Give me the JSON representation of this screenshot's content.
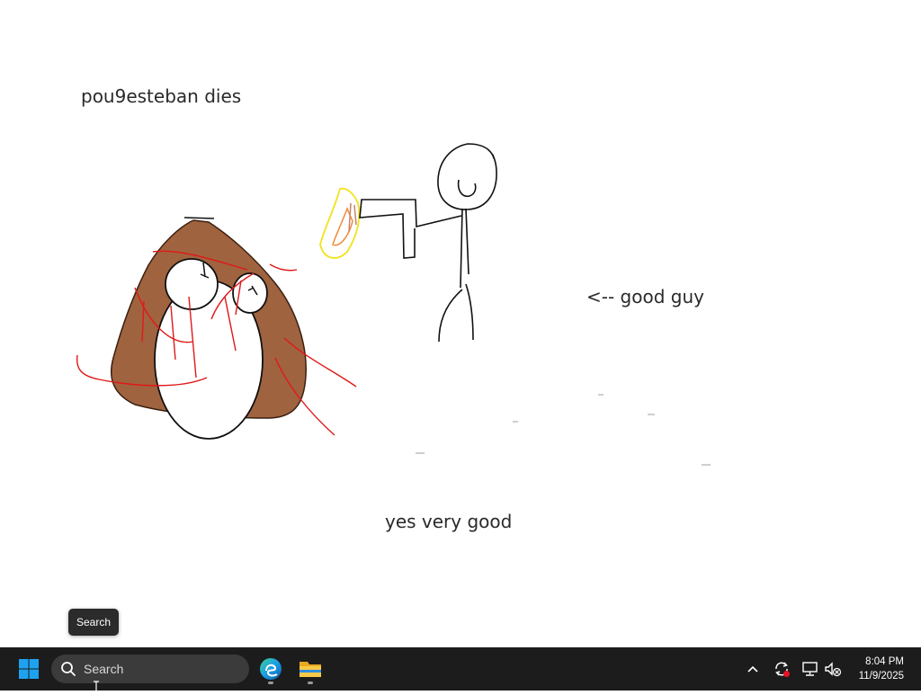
{
  "canvas": {
    "title_text": "pou9esteban dies",
    "label_good_guy": "<-- good guy",
    "label_bottom": "yes very good",
    "drawing_figures": [
      "brown-blob-creature",
      "stick-figure-good-guy",
      "flame",
      "red-scribbles"
    ],
    "colors": {
      "blob_fill": "#a0633f",
      "scribble": "#e01818",
      "flame_outer": "#f2e21c",
      "flame_inner": "#ef8a3a",
      "ink": "#111111"
    }
  },
  "tooltip": {
    "text": "Search"
  },
  "taskbar": {
    "search": {
      "placeholder": "Search"
    },
    "pinned_apps": [
      {
        "name": "Microsoft Edge",
        "icon": "edge-icon",
        "running": true
      },
      {
        "name": "File Explorer",
        "icon": "folder-icon",
        "running": true
      }
    ],
    "tray": {
      "icons": [
        "chevron-up-icon",
        "sync-alert-icon",
        "network-icon",
        "volume-muted-icon"
      ],
      "time": "8:04 PM",
      "date": "11/9/2025"
    },
    "colors": {
      "background": "#1c1c1c",
      "search_bg": "#3b3b3b",
      "start_blue": "#1ea2ef"
    }
  }
}
